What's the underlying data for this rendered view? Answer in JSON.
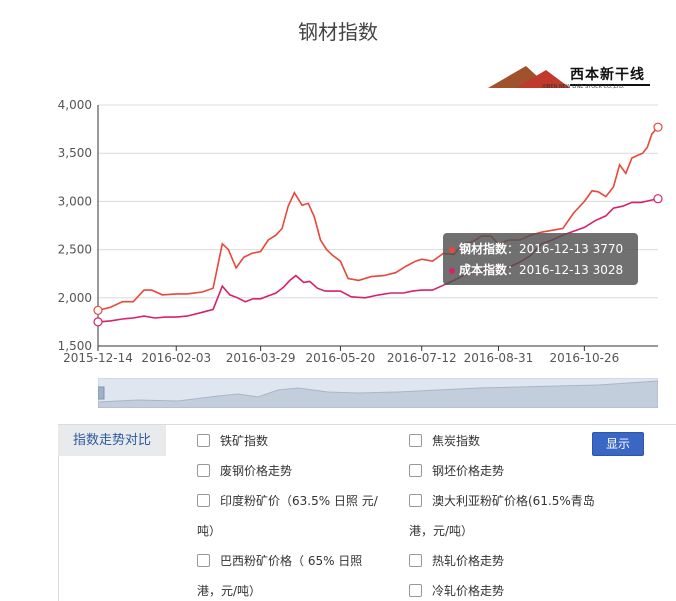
{
  "title": "钢材指数",
  "logo": {
    "name": "西本新干线",
    "sub": "XIBEN NEW LINE STOCK CO.,LTD."
  },
  "chart_data": {
    "type": "line",
    "title": "钢材指数",
    "xlim": [
      "2015-12-14",
      "2016-12-13"
    ],
    "ylim": [
      1500,
      4000
    ],
    "yticks": [
      "1,500",
      "2,000",
      "2,500",
      "3,000",
      "3,500",
      "4,000"
    ],
    "xticks": [
      "2015-12-14",
      "2016-02-03",
      "2016-03-29",
      "2016-05-20",
      "2016-07-12",
      "2016-08-31",
      "2016-10-26"
    ],
    "grid": true,
    "series": [
      {
        "name": "钢材指数",
        "color": "#e8473a",
        "points": [
          [
            "2015-12-14",
            1870
          ],
          [
            "2015-12-22",
            1900
          ],
          [
            "2015-12-30",
            1960
          ],
          [
            "2016-01-06",
            1960
          ],
          [
            "2016-01-13",
            2080
          ],
          [
            "2016-01-18",
            2080
          ],
          [
            "2016-01-25",
            2030
          ],
          [
            "2016-02-03",
            2040
          ],
          [
            "2016-02-10",
            2040
          ],
          [
            "2016-02-20",
            2060
          ],
          [
            "2016-02-27",
            2100
          ],
          [
            "2016-03-04",
            2560
          ],
          [
            "2016-03-08",
            2500
          ],
          [
            "2016-03-13",
            2310
          ],
          [
            "2016-03-18",
            2420
          ],
          [
            "2016-03-23",
            2460
          ],
          [
            "2016-03-29",
            2480
          ],
          [
            "2016-04-03",
            2600
          ],
          [
            "2016-04-08",
            2650
          ],
          [
            "2016-04-12",
            2720
          ],
          [
            "2016-04-16",
            2950
          ],
          [
            "2016-04-20",
            3090
          ],
          [
            "2016-04-25",
            2960
          ],
          [
            "2016-04-29",
            2980
          ],
          [
            "2016-05-03",
            2840
          ],
          [
            "2016-05-07",
            2600
          ],
          [
            "2016-05-11",
            2500
          ],
          [
            "2016-05-15",
            2440
          ],
          [
            "2016-05-20",
            2380
          ],
          [
            "2016-05-25",
            2200
          ],
          [
            "2016-06-01",
            2180
          ],
          [
            "2016-06-09",
            2220
          ],
          [
            "2016-06-17",
            2230
          ],
          [
            "2016-06-25",
            2260
          ],
          [
            "2016-07-02",
            2330
          ],
          [
            "2016-07-08",
            2380
          ],
          [
            "2016-07-12",
            2400
          ],
          [
            "2016-07-19",
            2380
          ],
          [
            "2016-07-26",
            2460
          ],
          [
            "2016-08-02",
            2450
          ],
          [
            "2016-08-08",
            2560
          ],
          [
            "2016-08-14",
            2580
          ],
          [
            "2016-08-20",
            2640
          ],
          [
            "2016-08-26",
            2640
          ],
          [
            "2016-08-31",
            2560
          ],
          [
            "2016-09-07",
            2600
          ],
          [
            "2016-09-14",
            2600
          ],
          [
            "2016-09-21",
            2650
          ],
          [
            "2016-09-28",
            2680
          ],
          [
            "2016-10-05",
            2700
          ],
          [
            "2016-10-12",
            2720
          ],
          [
            "2016-10-19",
            2880
          ],
          [
            "2016-10-26",
            3000
          ],
          [
            "2016-10-31",
            3110
          ],
          [
            "2016-11-04",
            3100
          ],
          [
            "2016-11-09",
            3050
          ],
          [
            "2016-11-14",
            3150
          ],
          [
            "2016-11-18",
            3380
          ],
          [
            "2016-11-22",
            3290
          ],
          [
            "2016-11-26",
            3450
          ],
          [
            "2016-11-30",
            3480
          ],
          [
            "2016-12-03",
            3500
          ],
          [
            "2016-12-06",
            3560
          ],
          [
            "2016-12-09",
            3700
          ],
          [
            "2016-12-13",
            3770
          ]
        ]
      },
      {
        "name": "成本指数",
        "color": "#d6226b",
        "points": [
          [
            "2015-12-14",
            1750
          ],
          [
            "2015-12-22",
            1760
          ],
          [
            "2015-12-30",
            1780
          ],
          [
            "2016-01-06",
            1790
          ],
          [
            "2016-01-13",
            1810
          ],
          [
            "2016-01-20",
            1790
          ],
          [
            "2016-01-27",
            1800
          ],
          [
            "2016-02-03",
            1800
          ],
          [
            "2016-02-10",
            1810
          ],
          [
            "2016-02-20",
            1850
          ],
          [
            "2016-02-27",
            1880
          ],
          [
            "2016-03-04",
            2120
          ],
          [
            "2016-03-09",
            2030
          ],
          [
            "2016-03-14",
            2000
          ],
          [
            "2016-03-19",
            1960
          ],
          [
            "2016-03-24",
            1990
          ],
          [
            "2016-03-29",
            1990
          ],
          [
            "2016-04-03",
            2020
          ],
          [
            "2016-04-08",
            2050
          ],
          [
            "2016-04-13",
            2110
          ],
          [
            "2016-04-17",
            2180
          ],
          [
            "2016-04-21",
            2230
          ],
          [
            "2016-04-26",
            2160
          ],
          [
            "2016-04-30",
            2170
          ],
          [
            "2016-05-05",
            2100
          ],
          [
            "2016-05-10",
            2070
          ],
          [
            "2016-05-20",
            2070
          ],
          [
            "2016-05-27",
            2010
          ],
          [
            "2016-06-05",
            2000
          ],
          [
            "2016-06-14",
            2030
          ],
          [
            "2016-06-22",
            2050
          ],
          [
            "2016-06-30",
            2050
          ],
          [
            "2016-07-06",
            2070
          ],
          [
            "2016-07-12",
            2080
          ],
          [
            "2016-07-19",
            2080
          ],
          [
            "2016-07-26",
            2130
          ],
          [
            "2016-08-02",
            2180
          ],
          [
            "2016-08-09",
            2240
          ],
          [
            "2016-08-16",
            2260
          ],
          [
            "2016-08-23",
            2300
          ],
          [
            "2016-08-31",
            2300
          ],
          [
            "2016-09-07",
            2320
          ],
          [
            "2016-09-14",
            2370
          ],
          [
            "2016-09-21",
            2440
          ],
          [
            "2016-09-28",
            2560
          ],
          [
            "2016-10-05",
            2600
          ],
          [
            "2016-10-12",
            2650
          ],
          [
            "2016-10-19",
            2690
          ],
          [
            "2016-10-26",
            2730
          ],
          [
            "2016-11-02",
            2800
          ],
          [
            "2016-11-09",
            2850
          ],
          [
            "2016-11-14",
            2930
          ],
          [
            "2016-11-20",
            2950
          ],
          [
            "2016-11-26",
            2990
          ],
          [
            "2016-12-02",
            2990
          ],
          [
            "2016-12-08",
            3010
          ],
          [
            "2016-12-13",
            3028
          ]
        ]
      }
    ]
  },
  "tooltip": {
    "rows": [
      {
        "name": "钢材指数",
        "date": "2016-12-13",
        "value": "3770",
        "color": "#e8473a"
      },
      {
        "name": "成本指数",
        "date": "2016-12-13",
        "value": "3028",
        "color": "#d6226b"
      }
    ],
    "sep": "："
  },
  "panel": {
    "label": "指数走势对比",
    "show_button": "显示",
    "options": [
      {
        "label": "铁矿指数"
      },
      {
        "label": "焦炭指数"
      },
      {
        "label": "废钢价格走势"
      },
      {
        "label": "钢坯价格走势"
      },
      {
        "label": "印度粉矿价（63.5% 日照 元/",
        "cont": "吨）"
      },
      {
        "label": "澳大利亚粉矿价格(61.5%青岛",
        "cont": "港，元/吨）"
      },
      {
        "label": "巴西粉矿价格（ 65% 日照",
        "cont": "港，元/吨）"
      },
      {
        "label": "热轧价格走势"
      },
      {
        "label": "冷轧价格走势"
      }
    ]
  }
}
